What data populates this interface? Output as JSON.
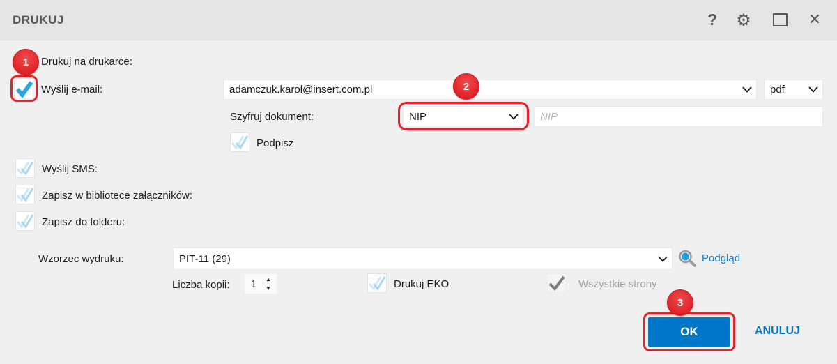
{
  "dialog": {
    "title": "DRUKUJ"
  },
  "titlebar": {
    "help_glyph": "?",
    "gear_glyph": "⚙",
    "close_glyph": "✕"
  },
  "options": {
    "print": {
      "label": "Drukuj na drukarce:"
    },
    "email": {
      "label": "Wyślij e-mail:",
      "address": "adamczuk.karol@insert.com.pl",
      "format": "pdf"
    },
    "encrypt": {
      "label": "Szyfruj dokument:",
      "method": "NIP",
      "value_placeholder": "NIP"
    },
    "sign": {
      "label": "Podpisz"
    },
    "sms": {
      "label": "Wyślij SMS:"
    },
    "attachments": {
      "label": "Zapisz w bibliotece załączników:"
    },
    "folder": {
      "label": "Zapisz do folderu:"
    }
  },
  "template": {
    "label": "Wzorzec wydruku:",
    "selected": "PIT-11 (29)",
    "preview": "Podgląd"
  },
  "copies": {
    "label": "Liczba kopii:",
    "value": "1"
  },
  "eco": {
    "label": "Drukuj EKO"
  },
  "all_pages": {
    "label": "Wszystkie strony"
  },
  "annotations": {
    "step1": "1",
    "step2": "2",
    "step3": "3"
  },
  "actions": {
    "ok": "OK",
    "cancel": "ANULUJ"
  },
  "colors": {
    "accent_blue": "#0077c8",
    "check_blue": "#2aa7e0",
    "check_light_blue": "#b3dcf0",
    "annotation_red": "#e8202a",
    "link_blue": "#0a74bf",
    "titlebar_gray": "#e5e5e5"
  }
}
